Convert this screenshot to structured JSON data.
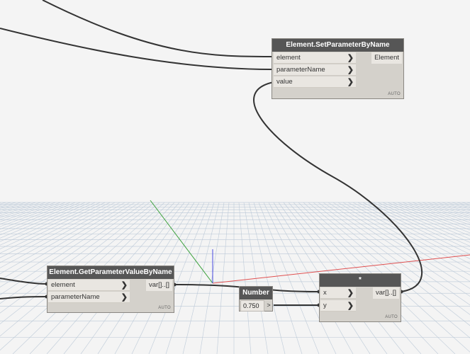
{
  "nodes": {
    "set_param": {
      "title": "Element.SetParameterByName",
      "inputs": [
        "element",
        "parameterName",
        "value"
      ],
      "output": "Element",
      "lacing": "AUTO"
    },
    "get_param": {
      "title": "Element.GetParameterValueByName",
      "inputs": [
        "element",
        "parameterName"
      ],
      "output": "var[]..[]",
      "lacing": "AUTO"
    },
    "number": {
      "title": "Number",
      "value": "0.750",
      "output_arrow": ">"
    },
    "multiply": {
      "title": "*",
      "inputs": [
        "x",
        "y"
      ],
      "output": "var[]..[]",
      "lacing": "AUTO"
    }
  },
  "colors": {
    "background": "#f4f4f4",
    "grid_line": "#b9c7d6",
    "node_header": "#565656",
    "node_body": "#d4d1cb",
    "wire": "#333333",
    "axis_x": "#e05050",
    "axis_y": "#3aa03a",
    "axis_z": "#4a4ae0"
  }
}
